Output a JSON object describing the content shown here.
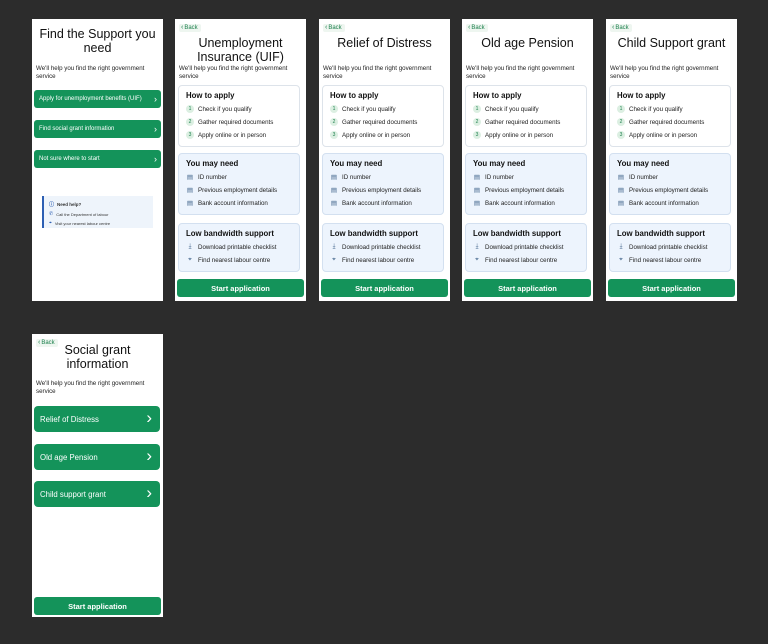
{
  "back_label": "Back",
  "subtitle": "We'll help you find the right government service",
  "home": {
    "title": "Find the Support you need",
    "options": [
      "Apply for unemployment benefits (UIF)",
      "Find social grant information",
      "Not sure where to start"
    ],
    "help": {
      "title": "Need help?",
      "items": [
        "Call the Department of labour",
        "Visit your nearest labour centre"
      ]
    }
  },
  "detail": {
    "how_title": "How to apply",
    "steps": [
      "Check if you qualify",
      "Gather required documents",
      "Apply online or in person"
    ],
    "need_title": "You may need",
    "needs": [
      "ID number",
      "Previous employment details",
      "Bank account information"
    ],
    "bw_title": "Low bandwidth support",
    "bw_items": [
      "Download printable checklist",
      "Find nearest labour centre"
    ],
    "start_label": "Start application"
  },
  "screens": {
    "uif": "Unemployment Insurance (UIF)",
    "rod": "Relief of Distress",
    "oap": "Old age Pension",
    "csg": "Child Support grant"
  },
  "social": {
    "title": "Social grant information",
    "options": [
      "Relief of Distress",
      "Old age Pension",
      "Child support grant"
    ],
    "start_label": "Start application"
  },
  "colors": {
    "primary": "#14935a",
    "info_bg": "#edf4fd",
    "page_bg": "#2c2c2c"
  }
}
